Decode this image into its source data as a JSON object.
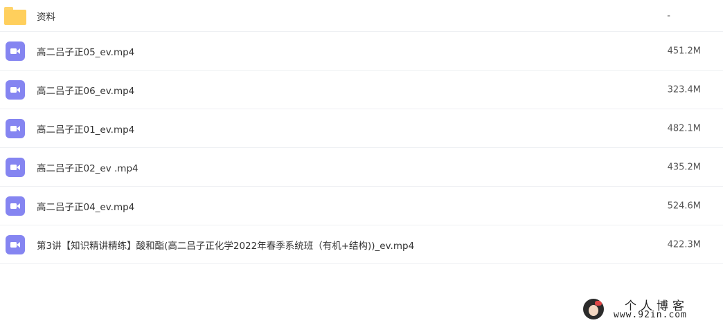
{
  "files": [
    {
      "name": "资料",
      "size": "-",
      "type": "folder",
      "icon": "folder-icon"
    },
    {
      "name": "高二吕子正05_ev.mp4",
      "size": "451.2M",
      "type": "video",
      "icon": "video-file-icon"
    },
    {
      "name": "高二吕子正06_ev.mp4",
      "size": "323.4M",
      "type": "video",
      "icon": "video-file-icon"
    },
    {
      "name": "高二吕子正01_ev.mp4",
      "size": "482.1M",
      "type": "video",
      "icon": "video-file-icon"
    },
    {
      "name": "高二吕子正02_ev .mp4",
      "size": "435.2M",
      "type": "video",
      "icon": "video-file-icon"
    },
    {
      "name": "高二吕子正04_ev.mp4",
      "size": "524.6M",
      "type": "video",
      "icon": "video-file-icon"
    },
    {
      "name": "第3讲【知识精讲精练】酸和酯(高二吕子正化学2022年春季系统班（有机+结构))_ev.mp4",
      "size": "422.3M",
      "type": "video",
      "icon": "video-file-icon"
    }
  ],
  "watermark": {
    "title": "个人博客",
    "url": "www.92in.com"
  },
  "colors": {
    "folder": "#ffcf5c",
    "video": "#8585f1",
    "divider": "#eef0f3"
  }
}
